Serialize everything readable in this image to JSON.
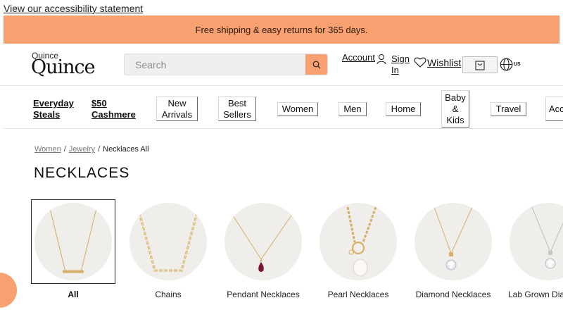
{
  "accessibility_link": "View our accessibility statement",
  "promo_banner": "Free shipping & easy returns for 365 days.",
  "header": {
    "logo_small": "Quince",
    "logo_big": "Quince",
    "search_placeholder": "Search",
    "account_label": "Account",
    "signin_label": "Sign In",
    "wishlist_label": "Wishlist",
    "region_label": "US"
  },
  "nav": {
    "links": [
      "Everyday Steals",
      "$50 Cashmere"
    ],
    "buttons": [
      "New Arrivals",
      "Best Sellers",
      "Women",
      "Men",
      "Home",
      "Baby & Kids",
      "Travel",
      "Acc"
    ]
  },
  "breadcrumb": {
    "items": [
      "Women",
      "Jewelry"
    ],
    "current": "Necklaces All"
  },
  "page_title": "NECKLACES",
  "categories": [
    "All",
    "Chains",
    "Pendant Necklaces",
    "Pearl Necklaces",
    "Diamond Necklaces",
    "Lab Grown Dia"
  ],
  "colors": {
    "accent": "#f8a06f",
    "gold": "#d6b069",
    "silver": "#bdbdbd"
  }
}
